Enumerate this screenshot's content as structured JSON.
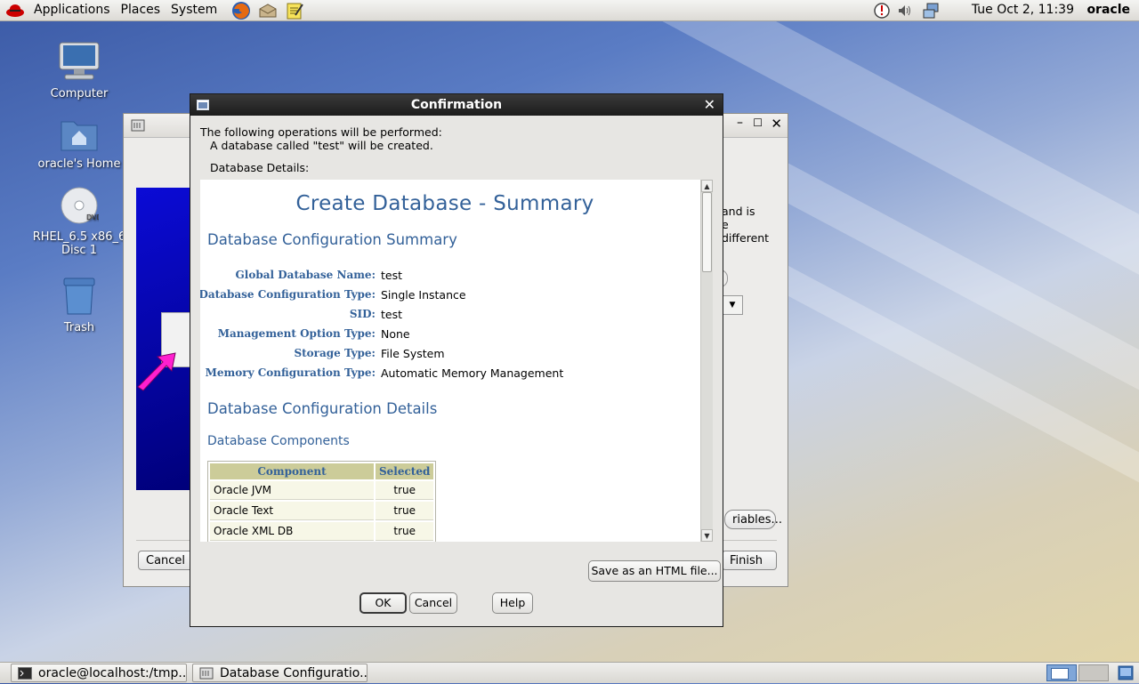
{
  "top_panel": {
    "menus": [
      "Applications",
      "Places",
      "System"
    ],
    "clock": "Tue Oct  2, 11:39",
    "user": "oracle"
  },
  "desktop": {
    "icons": [
      {
        "label": "Computer"
      },
      {
        "label": "oracle's Home"
      },
      {
        "label": "RHEL_6.5 x86_6 Disc 1"
      },
      {
        "label": "Trash"
      }
    ]
  },
  "background_window": {
    "partial_text": [
      "and is",
      "e",
      "different"
    ],
    "cancel_label": "Cancel",
    "variables_label": "riables...",
    "finish_label": "Finish"
  },
  "dialog": {
    "title": "Confirmation",
    "intro_line1": "The following operations will be performed:",
    "intro_line2": "A database called \"test\" will be created.",
    "details_label": "Database Details:",
    "summary": {
      "main_title": "Create Database - Summary",
      "section_summary": "Database Configuration Summary",
      "fields": [
        {
          "label": "Global Database Name:",
          "value": "test"
        },
        {
          "label": "Database Configuration Type:",
          "value": "Single Instance"
        },
        {
          "label": "SID:",
          "value": "test"
        },
        {
          "label": "Management Option Type:",
          "value": "None"
        },
        {
          "label": "Storage Type:",
          "value": "File System"
        },
        {
          "label": "Memory Configuration Type:",
          "value": "Automatic Memory Management"
        }
      ],
      "section_details": "Database Configuration Details",
      "section_components": "Database Components",
      "table_headers": [
        "Component",
        "Selected"
      ],
      "table_rows": [
        {
          "component": "Oracle JVM",
          "selected": "true"
        },
        {
          "component": "Oracle Text",
          "selected": "true"
        },
        {
          "component": "Oracle XML DB",
          "selected": "true"
        }
      ]
    },
    "save_html_label": "Save as an HTML file...",
    "ok_label": "OK",
    "cancel_label": "Cancel",
    "help_label": "Help"
  },
  "taskbar": {
    "tasks": [
      {
        "label": "oracle@localhost:/tmp..."
      },
      {
        "label": "Database Configuratio..."
      }
    ]
  }
}
